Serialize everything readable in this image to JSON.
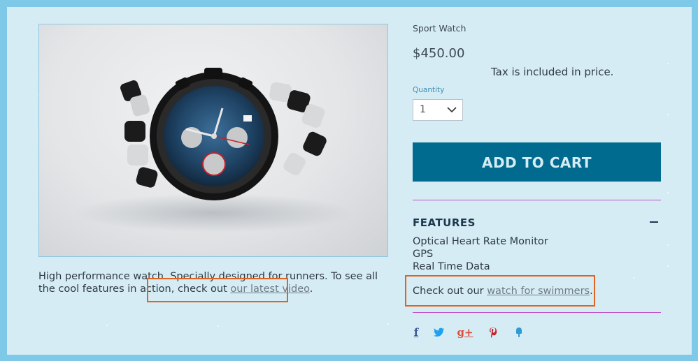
{
  "product": {
    "title": "Sport Watch",
    "price": "$450.00",
    "tax_note": "Tax is included in price.",
    "quantity_label": "Quantity",
    "quantity_value": "1",
    "add_to_cart_label": "ADD TO CART"
  },
  "description": {
    "text": "High performance watch. Specially designed for runners. To see all the cool features in action, check out ",
    "link_text": "our latest video",
    "end": "."
  },
  "features": {
    "title": "FEATURES",
    "items": [
      "Optical Heart Rate Monitor",
      "GPS",
      "Real Time Data"
    ]
  },
  "swim_note": {
    "text": "Check out our ",
    "link_text": "watch for swimmers",
    "end": "."
  },
  "social": {
    "facebook": "f",
    "googleplus": "g+"
  },
  "colors": {
    "page_background": "#7ec8e8",
    "panel_background": "#d6ecf5",
    "button": "#006b8f",
    "divider": "#c04fc8",
    "highlight": "#e0641e",
    "facebook": "#3b5998",
    "twitter": "#1da1f2",
    "googleplus": "#dd4b39",
    "pinterest": "#cb2027",
    "fancy": "#2f9bd6"
  },
  "icons": [
    "chevron-down-icon",
    "minus-icon",
    "facebook-icon",
    "twitter-icon",
    "googleplus-icon",
    "pinterest-icon",
    "fancy-icon"
  ]
}
